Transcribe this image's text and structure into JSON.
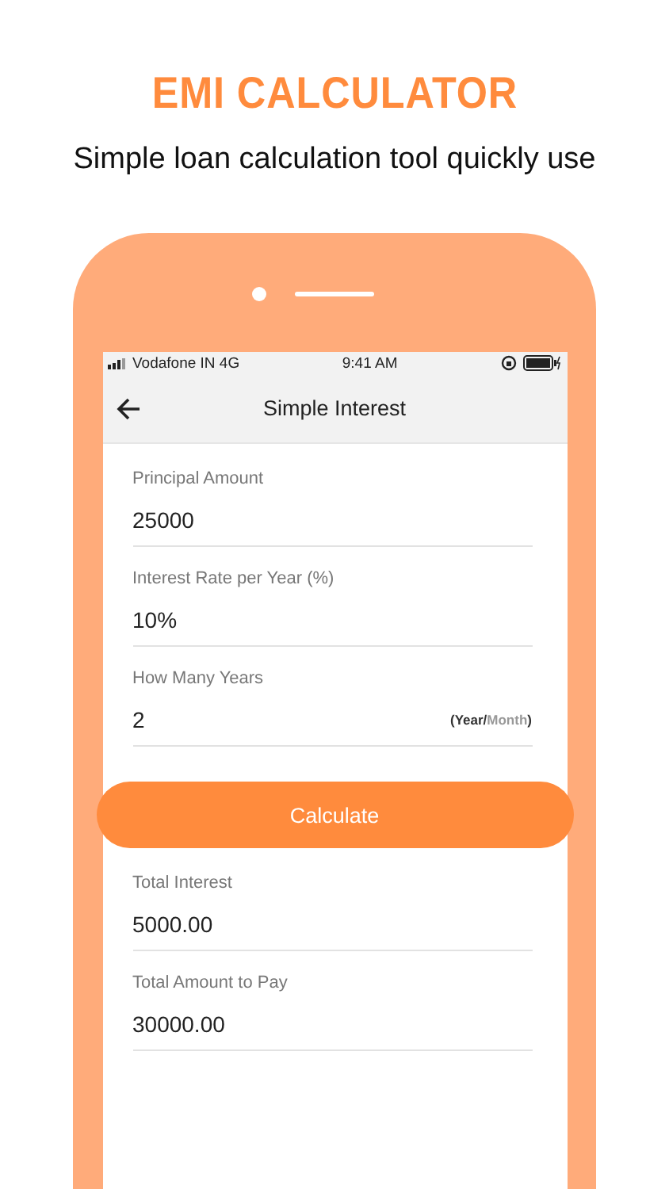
{
  "headline": "EMI CALCULATOR",
  "subtitle": "Simple loan calculation tool quickly use",
  "status_bar": {
    "carrier": "Vodafone IN 4G",
    "time": "9:41 AM"
  },
  "screen_title": "Simple Interest",
  "inputs": [
    {
      "label": "Principal Amount",
      "value": "25000"
    },
    {
      "label": "Interest Rate per Year (%)",
      "value": "10%"
    },
    {
      "label": "How Many Years",
      "value": "2",
      "unit_open": "(",
      "unit_separator": "/",
      "unit_close": ")",
      "units": [
        {
          "label": "Year",
          "selected": true
        },
        {
          "label": "Month",
          "selected": false
        }
      ]
    }
  ],
  "calculate_button": "Calculate",
  "results": [
    {
      "label": "Total Interest",
      "value": "5000.00"
    },
    {
      "label": "Total Amount to Pay",
      "value": "30000.00"
    }
  ]
}
